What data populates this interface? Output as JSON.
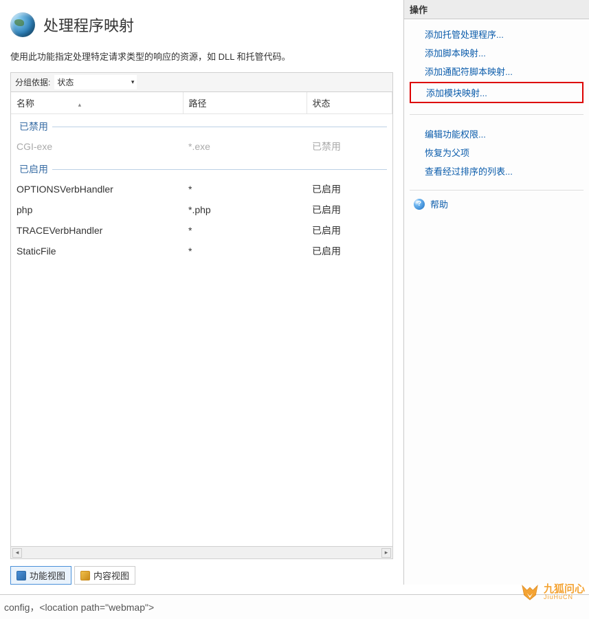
{
  "header": {
    "title": "处理程序映射",
    "description": "使用此功能指定处理特定请求类型的响应的资源，如 DLL 和托管代码。"
  },
  "grouping": {
    "label": "分组依据:",
    "selected": "状态"
  },
  "columns": {
    "name": "名称",
    "path": "路径",
    "state": "状态"
  },
  "groups": [
    {
      "label": "已禁用",
      "disabled": true,
      "rows": [
        {
          "name": "CGI-exe",
          "path": "*.exe",
          "state": "已禁用"
        }
      ]
    },
    {
      "label": "已启用",
      "disabled": false,
      "rows": [
        {
          "name": "OPTIONSVerbHandler",
          "path": "*",
          "state": "已启用"
        },
        {
          "name": "php",
          "path": "*.php",
          "state": "已启用"
        },
        {
          "name": "TRACEVerbHandler",
          "path": "*",
          "state": "已启用"
        },
        {
          "name": "StaticFile",
          "path": "*",
          "state": "已启用"
        }
      ]
    }
  ],
  "view_tabs": {
    "feature": "功能视图",
    "content": "内容视图"
  },
  "side": {
    "header": "操作",
    "links1": [
      "添加托管处理程序...",
      "添加脚本映射...",
      "添加通配符脚本映射...",
      "添加模块映射..."
    ],
    "highlight_index": 3,
    "links2": [
      "编辑功能权限...",
      "恢复为父项",
      "查看经过排序的列表..."
    ],
    "help": "帮助"
  },
  "status": "config，<location path=\"webmap\">",
  "watermark": {
    "cn": "九狐问心",
    "en": "JiuHuCN"
  }
}
